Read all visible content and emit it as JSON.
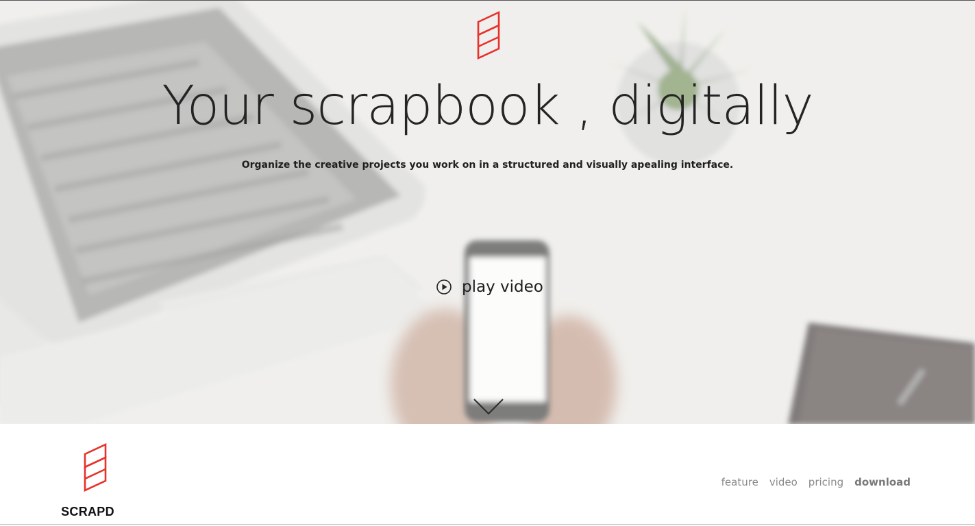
{
  "hero": {
    "title": "Your scrapbook , digitally",
    "subtitle": "Organize the creative projects you work on in a structured and visually apealing interface.",
    "play_label": "play video",
    "icons": {
      "logo": "scrapd-logo-icon",
      "play": "play-circle-icon",
      "scroll": "chevron-down-icon"
    }
  },
  "footer": {
    "brand_name": "SCRAPD",
    "nav": [
      {
        "label": "feature"
      },
      {
        "label": "video"
      },
      {
        "label": "pricing"
      },
      {
        "label": "download"
      }
    ]
  },
  "colors": {
    "brand_red": "#e8312a",
    "text_dark": "#242424",
    "nav_grey": "#8a8a8a"
  }
}
